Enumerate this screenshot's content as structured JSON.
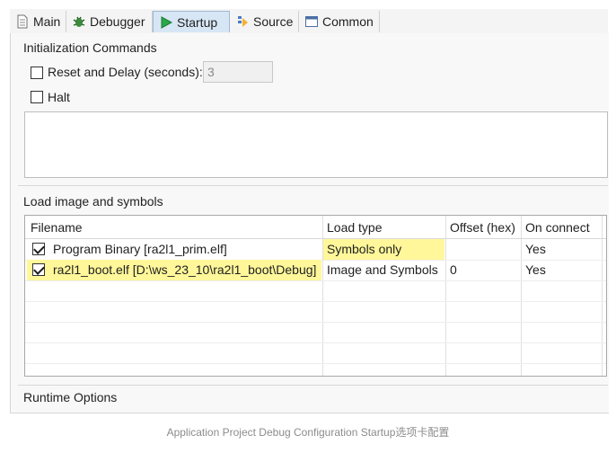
{
  "tabs": [
    {
      "label": "Main",
      "icon": "document-icon"
    },
    {
      "label": "Debugger",
      "icon": "bug-icon"
    },
    {
      "label": "Startup",
      "icon": "play-icon",
      "active": true
    },
    {
      "label": "Source",
      "icon": "source-icon"
    },
    {
      "label": "Common",
      "icon": "window-icon"
    }
  ],
  "init": {
    "title": "Initialization Commands",
    "reset_label": "Reset and Delay (seconds):",
    "reset_checked": false,
    "delay_value": "3",
    "halt_label": "Halt",
    "halt_checked": false
  },
  "load": {
    "title": "Load image and symbols",
    "columns": [
      "Filename",
      "Load type",
      "Offset (hex)",
      "On connect"
    ],
    "rows": [
      {
        "checked": true,
        "filename": "Program Binary [ra2l1_prim.elf]",
        "load_type": "Symbols only",
        "offset": "",
        "on_connect": "Yes"
      },
      {
        "checked": true,
        "filename": "ra2l1_boot.elf [D:\\ws_23_10\\ra2l1_boot\\Debug]",
        "load_type": "Image and Symbols",
        "offset": "0",
        "on_connect": "Yes"
      }
    ]
  },
  "runtime": {
    "title": "Runtime Options"
  },
  "caption": "Application Project Debug Configuration Startup选项卡配置",
  "colors": {
    "highlight": "#fff79a",
    "active_tab": "#d7e6f5",
    "play_green": "#2aa84a"
  }
}
